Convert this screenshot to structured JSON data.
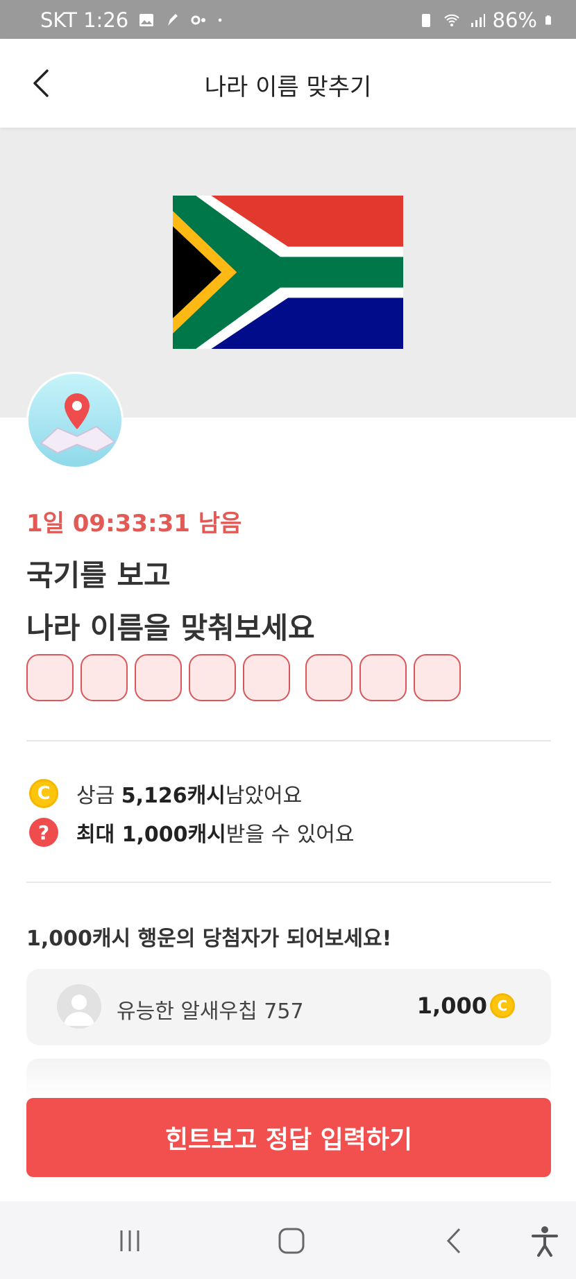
{
  "status_bar": {
    "carrier_time": "SKT 1:26",
    "battery": "86%"
  },
  "header": {
    "title": "나라 이름 맞추기"
  },
  "quiz": {
    "timer": "1일 09:33:31 남음",
    "question_line1": "국기를 보고",
    "question_line2": "나라 이름을 맞춰보세요",
    "answer_box_count": 8
  },
  "info": {
    "prize_prefix": "상금 ",
    "prize_amount": "5,126캐시",
    "prize_suffix": " 남았어요",
    "max_prefix": "최대 1,000캐시",
    "max_suffix": " 받을 수 있어요",
    "coin_glyph": "C",
    "question_glyph": "?"
  },
  "winners": {
    "title": "1,000캐시 행운의 당첨자가 되어보세요!",
    "items": [
      {
        "name": "유능한 알새우칩 757",
        "amount": "1,000"
      }
    ]
  },
  "cta": {
    "label": "힌트보고 정답 입력하기"
  },
  "colors": {
    "accent_red": "#f2504f",
    "timer_red": "#e25a55",
    "coin_yellow": "#ffc40c"
  },
  "icons": {
    "back": "chevron-left-icon",
    "map": "map-pin-icon",
    "coin": "coin-icon",
    "question": "question-icon",
    "avatar": "user-avatar-icon",
    "nav_recent": "recent-apps-icon",
    "nav_home": "home-icon",
    "nav_back": "back-icon",
    "nav_accessibility": "accessibility-icon"
  }
}
